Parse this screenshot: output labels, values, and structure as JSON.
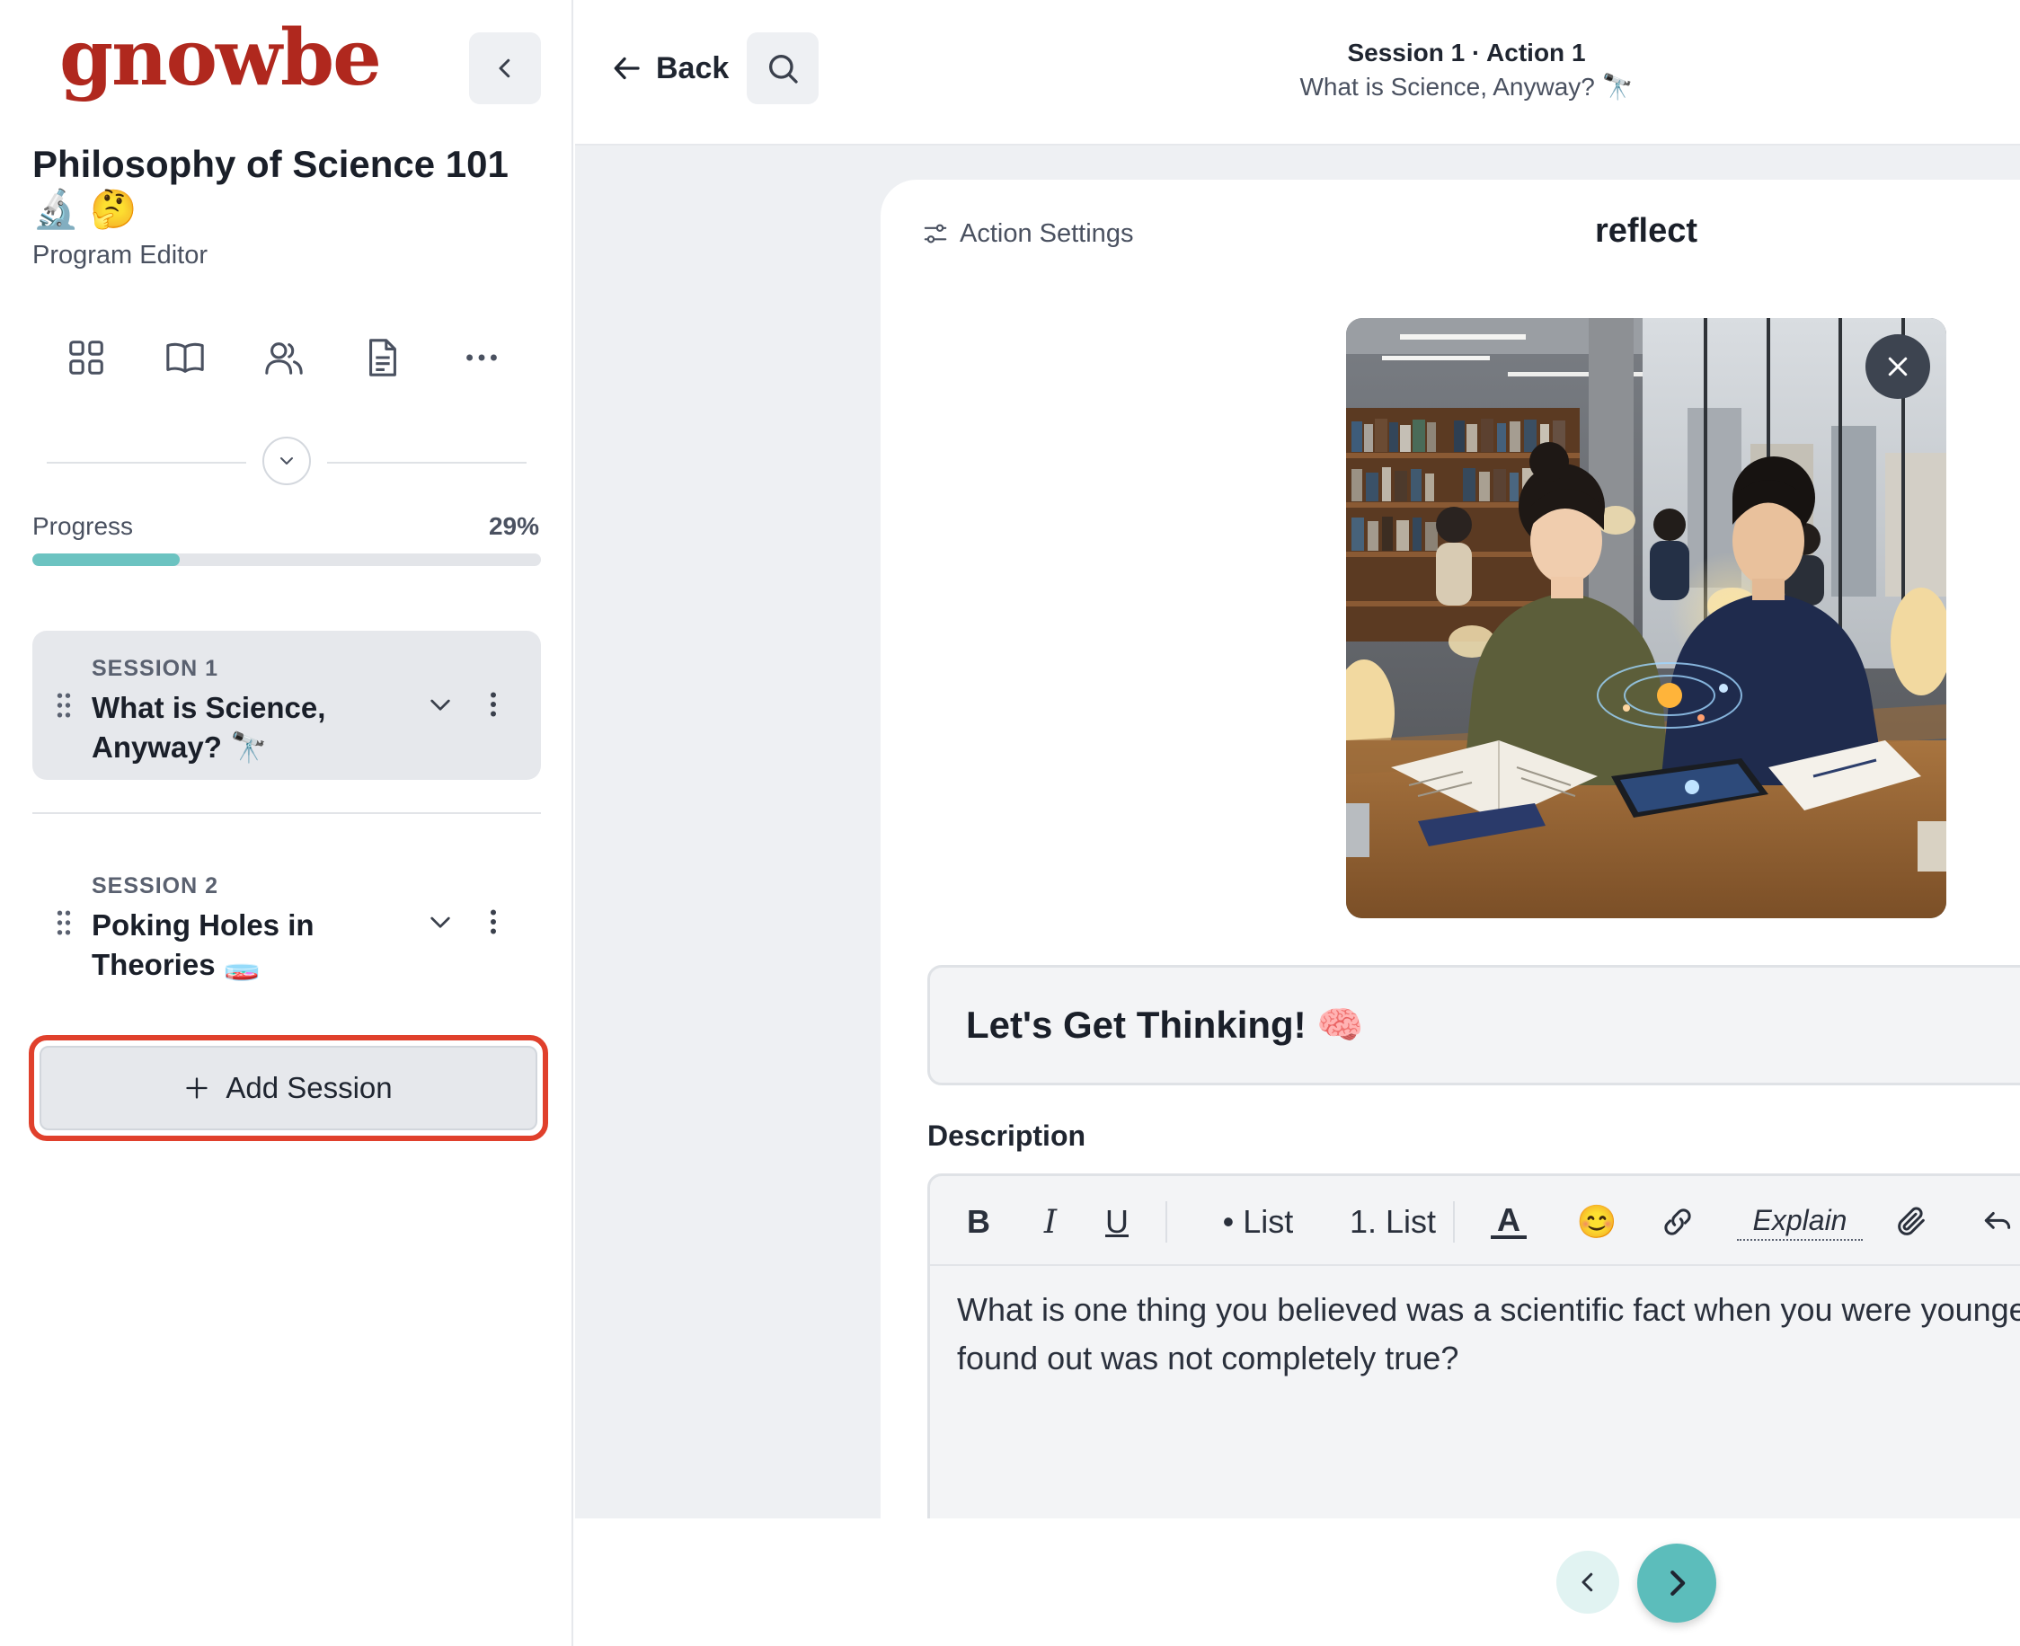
{
  "brand": {
    "logo_text": "gnowbe",
    "color": "#b0281e"
  },
  "sidebar": {
    "program_title": "Philosophy of Science 101 🔬 🤔",
    "program_subtitle": "Program Editor",
    "nav_icons": [
      "grid-icon",
      "book-icon",
      "users-icon",
      "document-icon",
      "more-icon"
    ],
    "progress": {
      "label": "Progress",
      "value_text": "29%",
      "value": 0.29,
      "color": "#6cc3c1"
    },
    "sessions": [
      {
        "label": "SESSION 1",
        "title": "What is Science, Anyway? 🔭",
        "active": true
      },
      {
        "label": "SESSION 2",
        "title": "Poking Holes in Theories 🧫",
        "active": false
      }
    ],
    "add_session_label": "Add Session",
    "highlight_color": "#e0402c"
  },
  "header": {
    "back_label": "Back",
    "crumb_line1": "Session 1 · Action 1",
    "crumb_line2": "What is Science, Anyway? 🔭"
  },
  "action": {
    "settings_label": "Action Settings",
    "type": "reflect",
    "title": "Let's Get Thinking! 🧠",
    "description_label": "Description",
    "toolbar": {
      "bold": "B",
      "italic": "I",
      "underline": "U",
      "bullet_list": "• List",
      "numbered_list": "1. List",
      "text_color": "A",
      "emoji": "😊",
      "explain": "Explain"
    },
    "description_text": "What is one thing you believed was a scientific fact when you were younger, but later found out was not completely true?"
  },
  "accent": "#5cbdbb"
}
